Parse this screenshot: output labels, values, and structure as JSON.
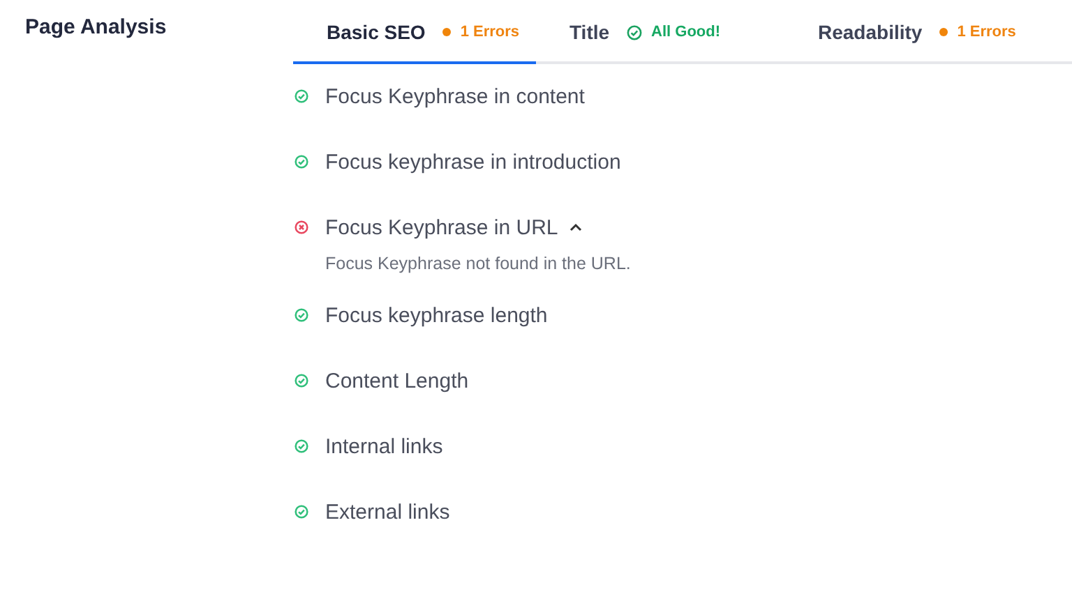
{
  "heading": "Page Analysis",
  "tabs": [
    {
      "label": "Basic SEO",
      "selected": true,
      "kind": "errors",
      "badge": "1 Errors"
    },
    {
      "label": "Title",
      "selected": false,
      "kind": "good",
      "badge": "All Good!"
    },
    {
      "label": "Readability",
      "selected": false,
      "kind": "errors",
      "badge": "1 Errors"
    }
  ],
  "checks": [
    {
      "label": "Focus Keyphrase in content",
      "passed": true
    },
    {
      "label": "Focus keyphrase in introduction",
      "passed": true
    },
    {
      "label": "Focus Keyphrase in URL",
      "passed": false,
      "expanded": true,
      "detail": "Focus Keyphrase not found in the URL."
    },
    {
      "label": "Focus keyphrase length",
      "passed": true
    },
    {
      "label": "Content Length",
      "passed": true
    },
    {
      "label": "Internal links",
      "passed": true
    },
    {
      "label": "External links",
      "passed": true
    }
  ]
}
